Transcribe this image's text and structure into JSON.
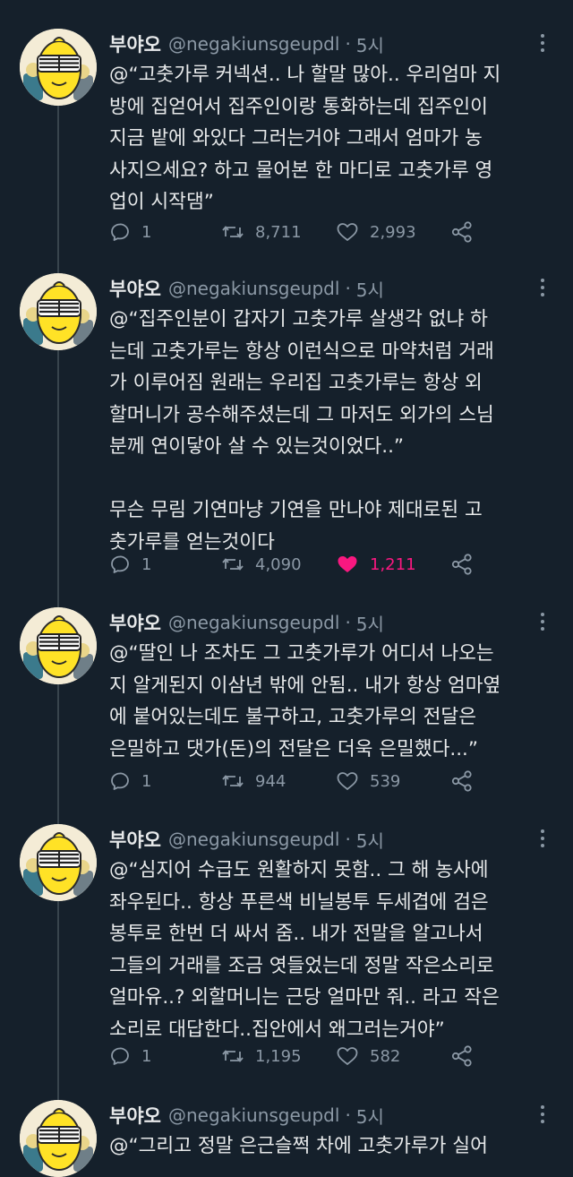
{
  "user": {
    "name": "부야오",
    "handle": "@negakiunsgeupdl",
    "time": "5시"
  },
  "tweets": [
    {
      "text": "@“고춧가루 커넥션.. 나 할말 많아.. 우리엄마 지\n방에 집얻어서 집주인이랑 통화하는데 집주인이\n지금 밭에 와있다 그러는거야 그래서 엄마가 농\n사지으세요? 하고 물어본 한 마디로 고춧가루 영\n업이 시작댐”",
      "replies": "1",
      "retweets": "8,711",
      "likes": "2,993",
      "liked": false
    },
    {
      "text": "@“집주인분이 갑자기 고춧가루 살생각 없냐 하\n는데 고춧가루는 항상 이런식으로 마약처럼 거래\n가 이루어짐 원래는 우리집 고춧가루는 항상 외\n할머니가 공수해주셨는데 그 마저도 외가의 스님\n분께 연이닿아 살 수 있는것이었다..”\n\n무슨 무림 기연마냥 기연을 만나야 제대로된 고\n춧가루를 얻는것이다",
      "replies": "1",
      "retweets": "4,090",
      "likes": "1,211",
      "liked": true
    },
    {
      "text": "@“딸인 나 조차도 그 고춧가루가 어디서 나오는\n지 알게된지 이삼년 밖에 안됨.. 내가 항상 엄마옆\n에 붙어있는데도 불구하고, 고춧가루의 전달은\n은밀하고 댓가(돈)의 전달은 더욱 은밀했다...”",
      "replies": "1",
      "retweets": "944",
      "likes": "539",
      "liked": false
    },
    {
      "text": "@“심지어 수급도 원활하지 못함.. 그 해 농사에\n좌우된다.. 항상 푸른색 비닐봉투 두세겹에 검은\n봉투로 한번 더 싸서 줌.. 내가 전말을 알고나서\n그들의 거래를 조금 엿들었는데 정말 작은소리로\n얼마유..? 외할머니는 근당 얼마만 줘.. 라고 작은\n소리로 대답한다..집안에서 왜그러는거야”",
      "replies": "1",
      "retweets": "1,195",
      "likes": "582",
      "liked": false
    },
    {
      "text": "@“그리고 정말 은근슬쩍 차에 고춧가루가 실어"
    }
  ],
  "icons": {
    "reply": "reply-icon",
    "retweet": "retweet-icon",
    "like": "heart-icon",
    "share": "share-icon",
    "more": "more-icon"
  },
  "colors": {
    "background": "#15202b",
    "muted": "#8b98a5",
    "like_active": "#f91880"
  }
}
